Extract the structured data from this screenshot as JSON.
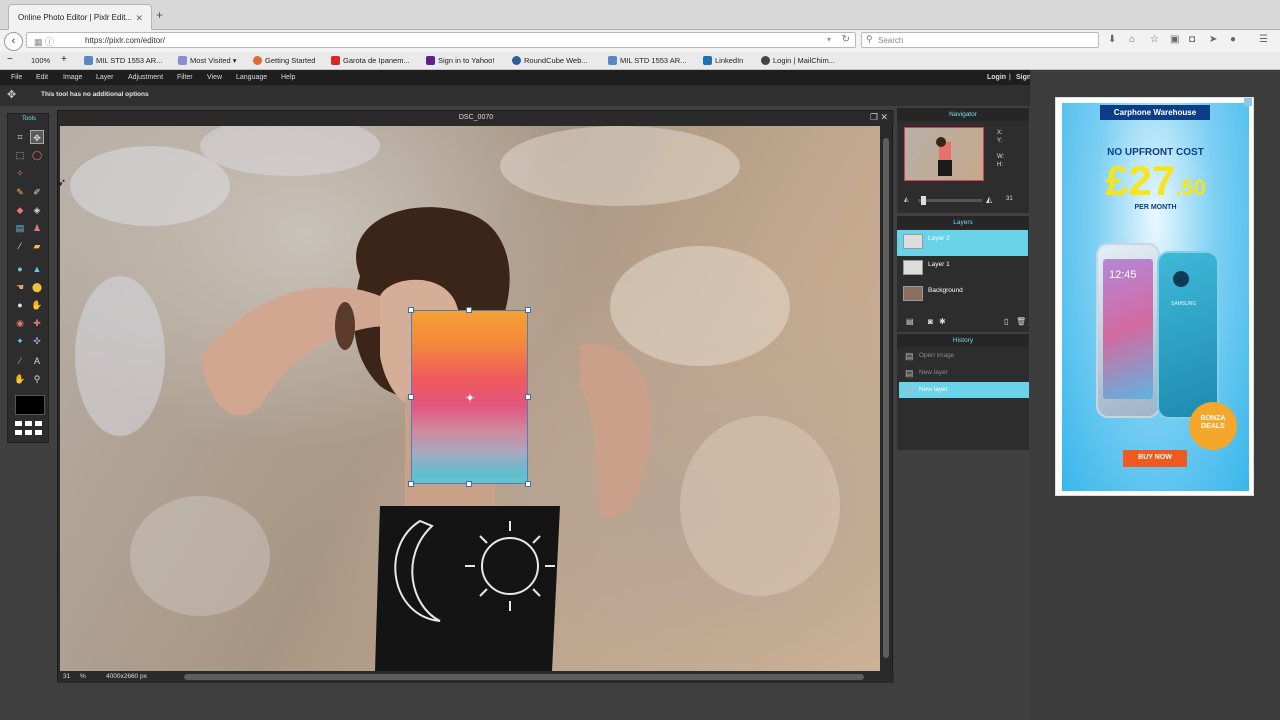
{
  "browser": {
    "tab_title": "Online Photo Editor | Pixlr Edit...",
    "tab_close": "✕",
    "new_tab": "+",
    "url": "https://pixlr.com/editor/",
    "search_placeholder": "Search",
    "zoom": "100%",
    "bookmarks": [
      {
        "label": "MIL STD 1553 AR...",
        "color": "#5b86c5"
      },
      {
        "label": "Most Visited",
        "color": "#8b8fd0"
      },
      {
        "label": "Getting Started",
        "color": "#e06b2e"
      },
      {
        "label": "Garota de Ipanem...",
        "color": "#d8262b"
      },
      {
        "label": "Sign in to Yahoo!",
        "color": "#5b1f8f"
      },
      {
        "label": "RoundCube Web...",
        "color": "#2f5e9a"
      },
      {
        "label": "MIL STD 1553 AR...",
        "color": "#5b86c5"
      },
      {
        "label": "LinkedIn",
        "color": "#1d71b4"
      },
      {
        "label": "Login | MailChim...",
        "color": "#444444"
      }
    ]
  },
  "menu": {
    "items": [
      "File",
      "Edit",
      "Image",
      "Layer",
      "Adjustment",
      "Filter",
      "View",
      "Language",
      "Help"
    ],
    "login": "Login",
    "sep": "|",
    "signup": "Sign"
  },
  "options_bar": {
    "text": "This tool has no additional options"
  },
  "tools": {
    "title": "Tools"
  },
  "document": {
    "title": "DSC_0070",
    "zoom": "31",
    "zoom_unit": "%",
    "size": "4000x2660 px"
  },
  "navigator": {
    "title": "Navigator",
    "x_label": "X:",
    "y_label": "Y:",
    "w_label": "W:",
    "h_label": "H:",
    "zoom": "31"
  },
  "layers": {
    "title": "Layers",
    "items": [
      {
        "name": "Layer 2",
        "selected": true
      },
      {
        "name": "Layer 1",
        "selected": false
      },
      {
        "name": "Background",
        "selected": false
      }
    ]
  },
  "history": {
    "title": "History",
    "items": [
      {
        "name": "Open image",
        "selected": false
      },
      {
        "name": "New layer",
        "selected": false
      },
      {
        "name": "New layer",
        "selected": true
      }
    ]
  },
  "ad": {
    "brand": "Carphone Warehouse",
    "line1": "NO UPFRONT COST",
    "price_main": "£27",
    "price_cents": ".50",
    "line2": "PER MONTH",
    "cta": "BUY NOW",
    "badge_line1": "BONZA",
    "badge_line2": "DEALS",
    "phone_brand": "SAMSUNG",
    "phone_time": "12:45"
  },
  "colors": {
    "accent": "#69d3ea",
    "selection_border": "#4a7fc4",
    "ad_blue": "#38b6ec",
    "ad_cta": "#f05a1e"
  }
}
